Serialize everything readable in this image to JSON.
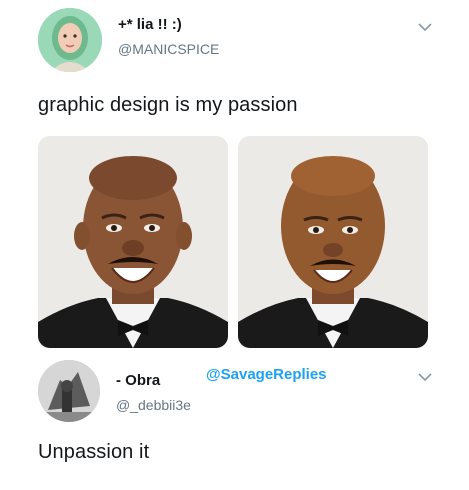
{
  "tweet1": {
    "display_name": "+* lia !! :)",
    "handle": "@MANICSPICE",
    "text": "graphic design is my passion",
    "avatar_icon": "user-avatar-icon",
    "menu_icon": "chevron-down-icon"
  },
  "tweet2": {
    "display_name": "- Obra",
    "handle": "@_debbii3e",
    "mention": "@SavageReplies",
    "text": "Unpassion it",
    "avatar_icon": "user-avatar-icon",
    "menu_icon": "chevron-down-icon"
  },
  "colors": {
    "link": "#1da1f2",
    "secondary_text": "#657786",
    "primary_text": "#14171a",
    "photo_background": "#eceae6"
  }
}
